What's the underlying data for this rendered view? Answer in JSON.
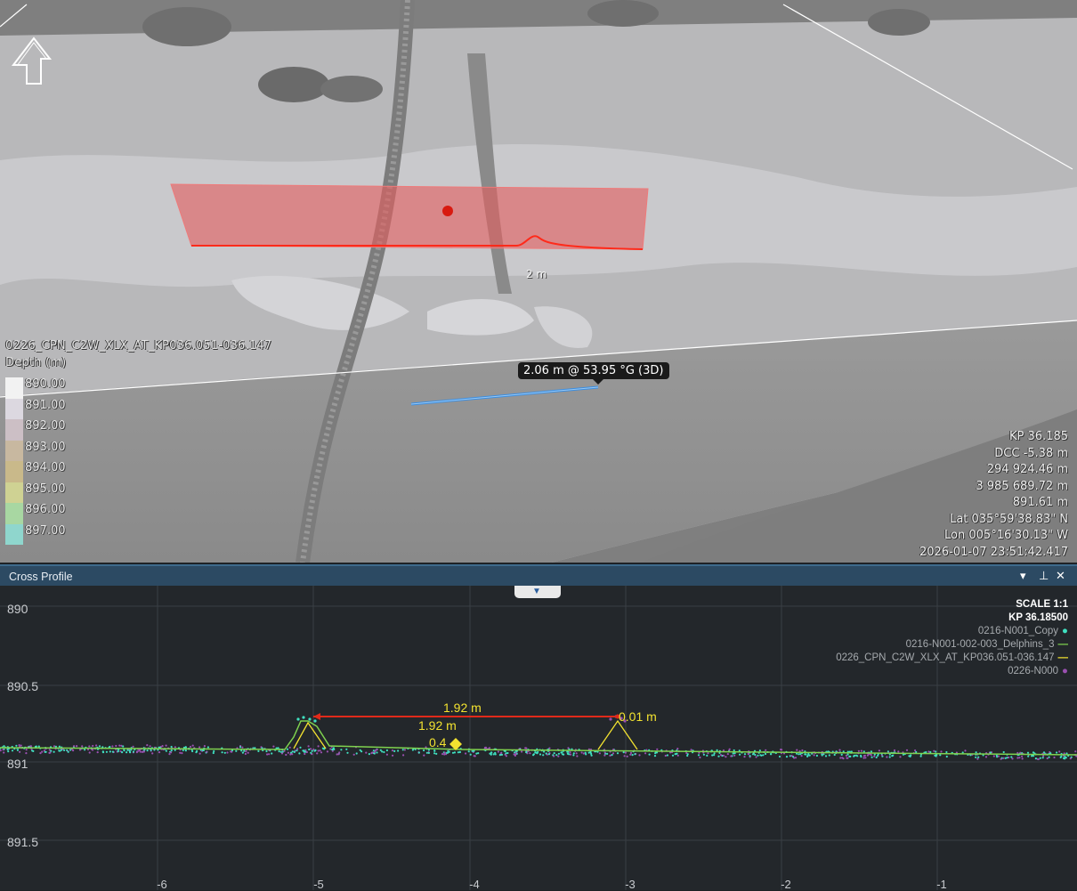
{
  "viewport": {
    "dataset_title": "0226_CPN_C2W_XLX_AT_KP036.051-036.147",
    "depth_label": "Depth (m)",
    "legend": [
      {
        "label": "890.00",
        "color": "#f2f2f2"
      },
      {
        "label": "891.00",
        "color": "#dcd8e0"
      },
      {
        "label": "892.00",
        "color": "#ccbfc5"
      },
      {
        "label": "893.00",
        "color": "#c8b8a0"
      },
      {
        "label": "894.00",
        "color": "#c9b98a"
      },
      {
        "label": "895.00",
        "color": "#cfd293"
      },
      {
        "label": "896.00",
        "color": "#a8d7a2"
      },
      {
        "label": "897.00",
        "color": "#8fd6cd"
      }
    ],
    "distance_label": "2 m",
    "measure_tooltip": "2.06 m @ 53.95 °G (3D)",
    "readout": [
      "KP 36.185",
      "DCC -5.38 m",
      "294 924.46 m",
      "3 985 689.72 m",
      "891.61 m",
      "Lat 035°59'38.83\" N",
      "Lon 005°16'30.13\" W",
      "2026-01-07 23:51:42.417"
    ],
    "compass_icon": "north-arrow-icon"
  },
  "panel": {
    "title": "Cross Profile",
    "dropdown_icon": "chevron-down-icon",
    "pin_icon": "pin-icon",
    "close_icon": "close-icon",
    "collapse_icon": "triangle-down-icon"
  },
  "profile": {
    "scale": "SCALE 1:1",
    "kp": "KP 36.18500",
    "legend": [
      {
        "name": "0216-N001_Copy",
        "color": "#3fe0c0",
        "mark": "●"
      },
      {
        "name": "0216-N001-002-003_Delphins_3",
        "color": "#7fd24f",
        "mark": "—"
      },
      {
        "name": "0226_CPN_C2W_XLX_AT_KP036.051-036.147",
        "color": "#f2e230",
        "mark": "—"
      },
      {
        "name": "0226-N000",
        "color": "#9a50b0",
        "mark": "●"
      }
    ],
    "y_ticks": [
      "890",
      "890.5",
      "891",
      "891.5"
    ],
    "x_ticks": [
      "-6",
      "-5",
      "-4",
      "-3",
      "-2",
      "-1"
    ],
    "annotations": {
      "width_red": "1.92 m",
      "width_yellow": "1.92 m",
      "height_right": "0.01 m",
      "height_mid": "0.4"
    },
    "colors": {
      "red": "#e02a1a",
      "yellow": "#f2e230",
      "cyan": "#3fe0c0",
      "purple": "#9a50b0",
      "green": "#7fd24f"
    }
  }
}
